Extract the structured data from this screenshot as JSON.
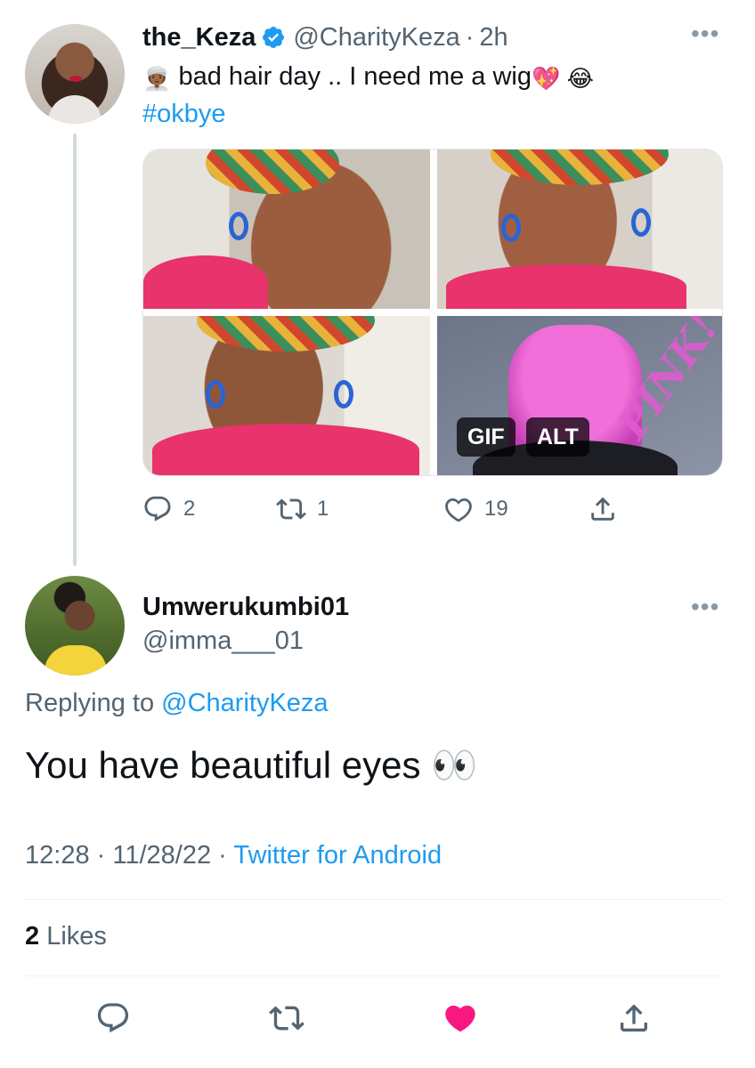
{
  "original_tweet": {
    "display_name": "the_Keza",
    "verified": true,
    "handle": "@CharityKeza",
    "time": "2h",
    "separator": "·",
    "text": "bad hair day .. I need me a wig",
    "emoji_leading": "👳🏾‍♀️",
    "emoji_trailing": "💖 😂",
    "hashtag": "#okbye",
    "media_badges": {
      "gif": "GIF",
      "alt": "ALT"
    },
    "media_overlay_text": "PINK!",
    "actions": {
      "reply_count": "2",
      "retweet_count": "1",
      "like_count": "19"
    }
  },
  "reply_tweet": {
    "display_name": "Umwerukumbi01",
    "handle": "@imma___01",
    "replying_to_prefix": "Replying to",
    "replying_to_handle": "@CharityKeza",
    "text": "You have beautiful eyes",
    "text_emoji": "👀",
    "time": "12:28",
    "date": "11/28/22",
    "source": "Twitter for Android",
    "separator": "·",
    "likes_count": "2",
    "likes_label": "Likes",
    "liked": true
  },
  "icons": {
    "more": "more-options-icon",
    "verified": "verified-badge-icon",
    "reply": "reply-icon",
    "retweet": "retweet-icon",
    "like": "heart-icon",
    "share": "share-icon"
  },
  "colors": {
    "link": "#1d9bf0",
    "secondary_text": "#536471",
    "like_active": "#f91880",
    "verified": "#1d9bf0"
  }
}
